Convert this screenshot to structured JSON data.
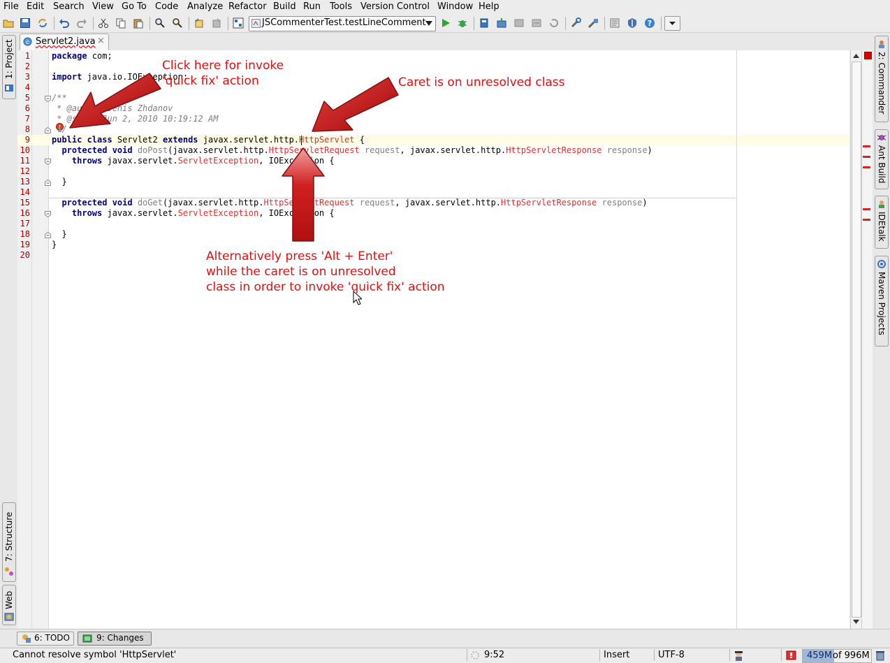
{
  "menu": [
    "File",
    "Edit",
    "Search",
    "View",
    "Go To",
    "Code",
    "Analyze",
    "Refactor",
    "Build",
    "Run",
    "Tools",
    "Version Control",
    "Window",
    "Help"
  ],
  "toolbar": {
    "run_config": "JSCommenterTest.testLineComment"
  },
  "left_tabs": {
    "project": "1: Project",
    "structure": "7: Structure",
    "web": "Web"
  },
  "right_tabs": {
    "commander": "2: Commander",
    "ant": "Ant Build",
    "idetalk": "IDEtalk",
    "maven": "Maven Projects"
  },
  "editor_tab": {
    "filename": "Servlet2.java",
    "close": "×"
  },
  "line_numbers": [
    "1",
    "2",
    "3",
    "4",
    "5",
    "6",
    "7",
    "8",
    "9",
    "10",
    "11",
    "12",
    "13",
    "14",
    "15",
    "16",
    "17",
    "18",
    "19",
    "20"
  ],
  "code": {
    "l1_kw": "package",
    "l1_rest": " com;",
    "l3_kw": "import",
    "l3_rest": " java.io.IOException;",
    "l5": "/**",
    "l6": " * @author Denis Zhdanov",
    "l7": " * @since Jun 2, 2010 10:19:12 AM",
    "l8": " */",
    "l9_kw1": "public class",
    "l9_name": " Servlet2 ",
    "l9_kw2": "extends",
    "l9_pkg": " javax.servlet.http.",
    "l9_err": "HttpServlet",
    "l9_end": " {",
    "l10_kw": "  protected void",
    "l10_m": " doPost",
    "l10_a": "(javax.servlet.http.",
    "l10_e1": "HttpServletRequest",
    "l10_p1": " request",
    "l10_b": ", javax.servlet.http.",
    "l10_e2": "HttpServletResponse",
    "l10_p2": " response",
    "l10_c": ")",
    "l11_kw": "    throws",
    "l11_a": " javax.servlet.",
    "l11_e": "ServletException",
    "l11_b": ", IOException {",
    "l13": "  }",
    "l15_kw": "  protected void",
    "l15_m": " doGet",
    "l15_a": "(javax.servlet.http.",
    "l15_e1": "HttpServletRequest",
    "l15_p1": " request",
    "l15_b": ", javax.servlet.http.",
    "l15_e2": "HttpServletResponse",
    "l15_p2": " response",
    "l15_c": ")",
    "l16_kw": "    throws",
    "l16_a": " javax.servlet.",
    "l16_e": "ServletException",
    "l16_b": ", IOException {",
    "l18": "  }",
    "l19": "}"
  },
  "annotations": {
    "a1_line1": "Click here for invoke",
    "a1_line2": "'quick fix' action",
    "a2": "Caret is on unresolved class",
    "a3_line1": "Alternatively press 'Alt + Enter'",
    "a3_line2": "while the caret is on unresolved",
    "a3_line3": "class in order to invoke 'quick fix' action"
  },
  "bottom_tabs": {
    "todo": "6: TODO",
    "changes": "9: Changes"
  },
  "status": {
    "message": "Cannot resolve symbol 'HttpServlet'",
    "position": "9:52",
    "mode": "Insert",
    "encoding": "UTF-8",
    "memory_used": "459M",
    "memory_total": "of 996M",
    "memory_fraction": 0.46
  },
  "colors": {
    "error": "#e03030",
    "keyword": "#000080",
    "annotation": "#e01010",
    "arrow": "#c41010"
  }
}
